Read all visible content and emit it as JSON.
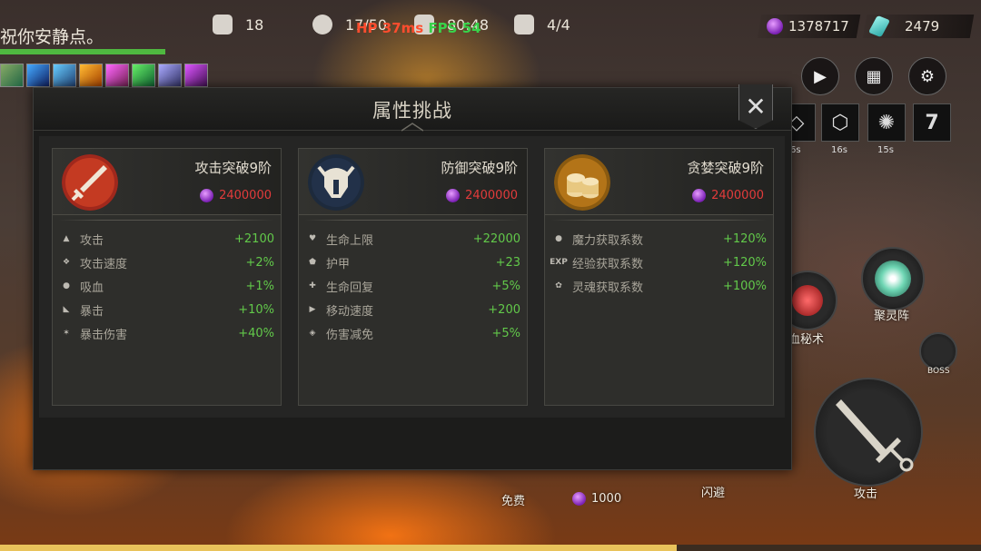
{
  "hud": {
    "chat_text": "祝你安静点。",
    "fist_count": "18",
    "hp_text": "17/50",
    "horn_text": "80:48",
    "wave_text": "4/4",
    "ping_text": "HP 37ms",
    "fps_text": "FPS 54",
    "currency_soul": "1378717",
    "currency_crystal": "2479",
    "green_bar_fraction": 1.0,
    "bottom_bar_fraction": 0.69
  },
  "top_buttons": [
    {
      "name": "play-button",
      "icon": "▶"
    },
    {
      "name": "shop-button",
      "icon": "▦"
    },
    {
      "name": "settings-button",
      "icon": "⚙"
    }
  ],
  "skill_slots": [
    {
      "glyph": "◇",
      "cd": "6s"
    },
    {
      "glyph": "⬡",
      "cd": "16s"
    },
    {
      "glyph": "✺",
      "cd": "15s"
    },
    {
      "glyph": "7",
      "cd": ""
    }
  ],
  "right_skills": {
    "blood": "血秘术",
    "gather": "聚灵阵",
    "boss": "BOSS",
    "attack": "攻击"
  },
  "bottom_actions": {
    "free": "免费",
    "cost": "1000",
    "dodge": "闪避"
  },
  "modal": {
    "title": "属性挑战",
    "close_glyph": "✕",
    "cards": [
      {
        "name": "攻击突破9阶",
        "cost": "2400000",
        "emblem": "sword",
        "attrs": [
          {
            "icon": "dagger",
            "label": "攻击",
            "value": "+2100"
          },
          {
            "icon": "wing",
            "label": "攻击速度",
            "value": "+2%"
          },
          {
            "icon": "drop",
            "label": "吸血",
            "value": "+1%"
          },
          {
            "icon": "claw",
            "label": "暴击",
            "value": "+10%"
          },
          {
            "icon": "burst",
            "label": "暴击伤害",
            "value": "+40%"
          }
        ]
      },
      {
        "name": "防御突破9阶",
        "cost": "2400000",
        "emblem": "helmet",
        "attrs": [
          {
            "icon": "heart",
            "label": "生命上限",
            "value": "+22000"
          },
          {
            "icon": "shield",
            "label": "护甲",
            "value": "+23"
          },
          {
            "icon": "heal",
            "label": "生命回复",
            "value": "+5%"
          },
          {
            "icon": "boot",
            "label": "移动速度",
            "value": "+200"
          },
          {
            "icon": "guard",
            "label": "伤害减免",
            "value": "+5%"
          }
        ]
      },
      {
        "name": "贪婪突破9阶",
        "cost": "2400000",
        "emblem": "coins",
        "attrs": [
          {
            "icon": "bomb",
            "label": "魔力获取系数",
            "value": "+120%"
          },
          {
            "icon": "EXP",
            "label": "经验获取系数",
            "value": "+120%"
          },
          {
            "icon": "soul",
            "label": "灵魂获取系数",
            "value": "+100%"
          }
        ]
      }
    ]
  }
}
